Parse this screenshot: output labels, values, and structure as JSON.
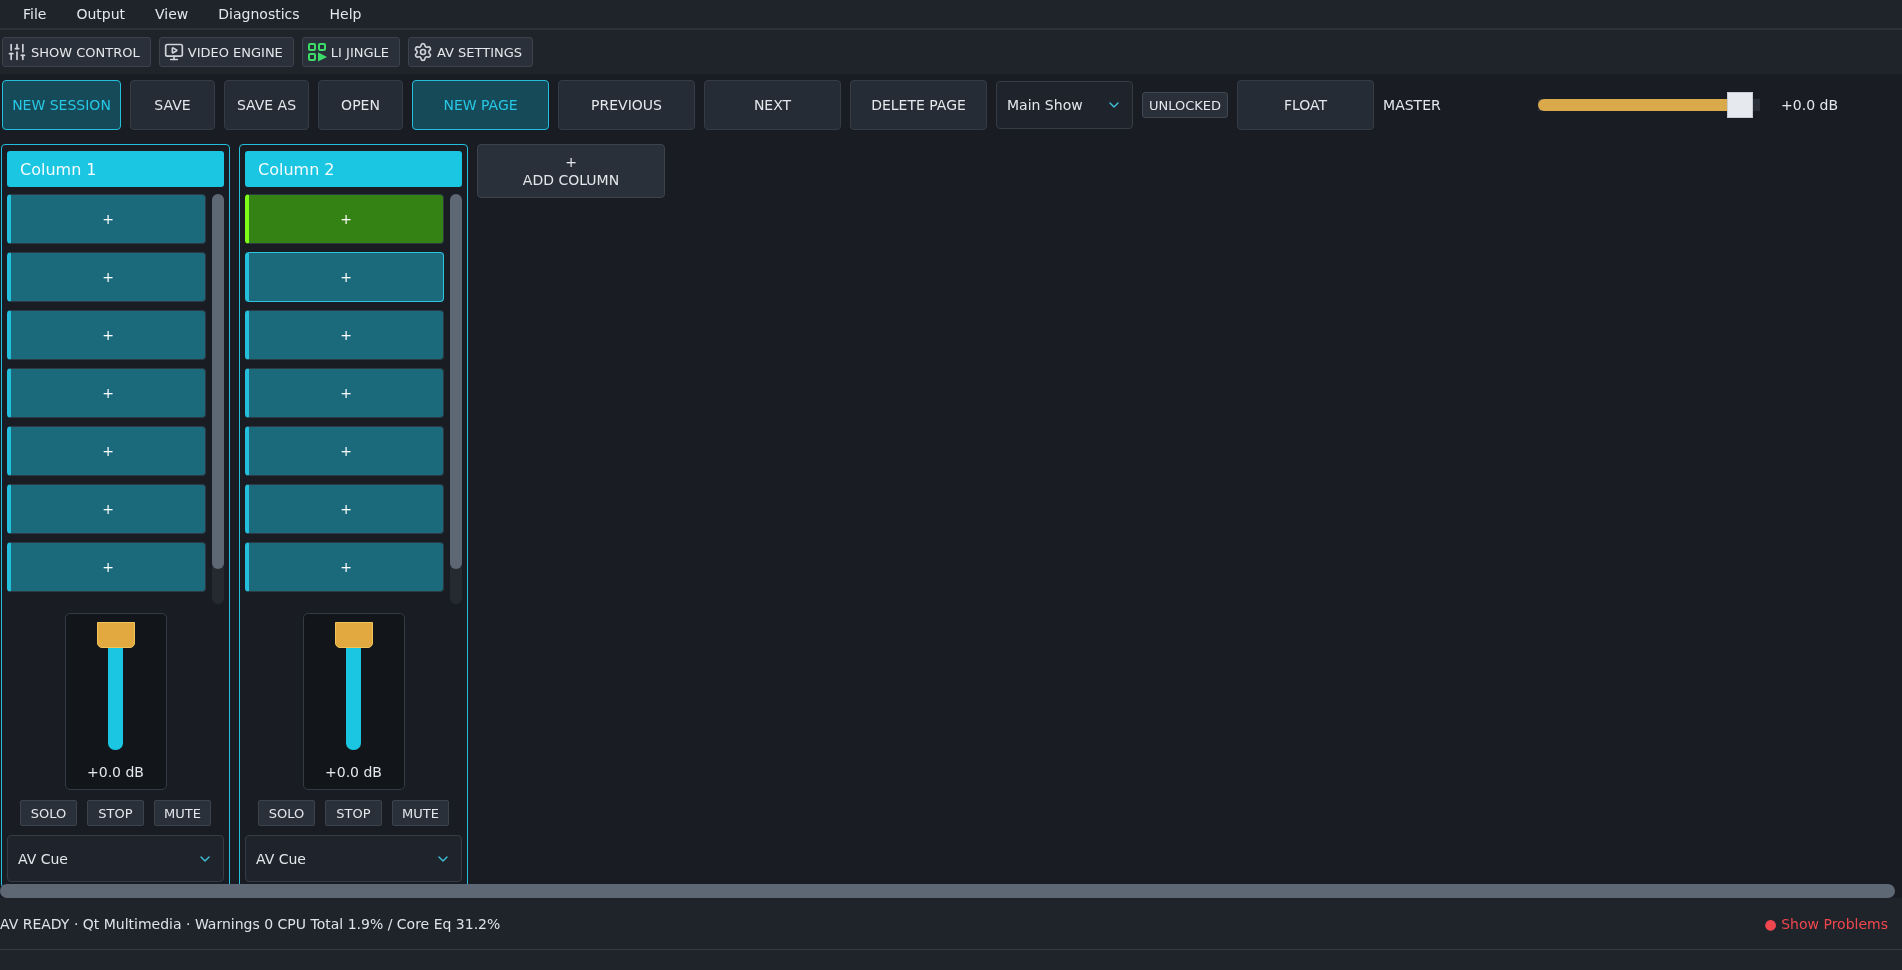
{
  "menu": [
    "File",
    "Output",
    "View",
    "Diagnostics",
    "Help"
  ],
  "toolbar": [
    {
      "kind": "sliders",
      "label": "SHOW CONTROL"
    },
    {
      "kind": "monitor",
      "label": "VIDEO ENGINE"
    },
    {
      "kind": "grid",
      "label": "LI JINGLE"
    },
    {
      "kind": "gear",
      "label": "AV SETTINGS"
    }
  ],
  "controls": [
    {
      "label": "NEW SESSION",
      "highlighted": true
    },
    {
      "label": "SAVE",
      "highlighted": false
    },
    {
      "label": "SAVE AS",
      "highlighted": false
    },
    {
      "label": "OPEN",
      "highlighted": false
    },
    {
      "label": "NEW PAGE",
      "highlighted": true
    },
    {
      "label": "PREVIOUS",
      "highlighted": false
    },
    {
      "label": "NEXT",
      "highlighted": false
    },
    {
      "label": "DELETE PAGE",
      "highlighted": false
    }
  ],
  "page_select": {
    "value": "Main Show"
  },
  "lock": {
    "label": "UNLOCKED"
  },
  "float": {
    "label": "FLOAT"
  },
  "master": {
    "label": "MASTER",
    "level": 0.97,
    "reading": "+0.0 dB"
  },
  "columns": [
    {
      "title": "Column 1",
      "slots": [
        {
          "label": "+",
          "playing": false,
          "selected": false
        },
        {
          "label": "+",
          "playing": false,
          "selected": false
        },
        {
          "label": "+",
          "playing": false,
          "selected": false
        },
        {
          "label": "+",
          "playing": false,
          "selected": false
        },
        {
          "label": "+",
          "playing": false,
          "selected": false
        },
        {
          "label": "+",
          "playing": false,
          "selected": false
        },
        {
          "label": "+",
          "playing": false,
          "selected": false
        }
      ],
      "fader": {
        "level": 1,
        "reading": "+0.0 dB"
      },
      "buttons": [
        "SOLO",
        "STOP",
        "MUTE"
      ],
      "type": "AV Cue"
    },
    {
      "title": "Column 2",
      "slots": [
        {
          "label": "+",
          "playing": true,
          "selected": false
        },
        {
          "label": "+",
          "playing": false,
          "selected": true
        },
        {
          "label": "+",
          "playing": false,
          "selected": false
        },
        {
          "label": "+",
          "playing": false,
          "selected": false
        },
        {
          "label": "+",
          "playing": false,
          "selected": false
        },
        {
          "label": "+",
          "playing": false,
          "selected": false
        },
        {
          "label": "+",
          "playing": false,
          "selected": false
        }
      ],
      "fader": {
        "level": 1,
        "reading": "+0.0 dB"
      },
      "buttons": [
        "SOLO",
        "STOP",
        "MUTE"
      ],
      "type": "AV Cue"
    }
  ],
  "add_column": {
    "icon": "+",
    "label": "ADD COLUMN"
  },
  "status_bar": {
    "text": "AV READY · Qt Multimedia · Warnings 0 CPU Total 1.9% / Core Eq 31.2%",
    "problems": "● Show Problems"
  }
}
